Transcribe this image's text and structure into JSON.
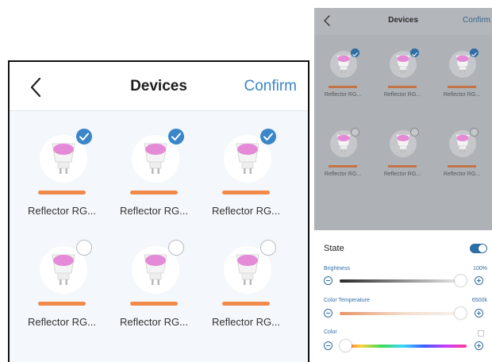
{
  "left": {
    "header": {
      "title": "Devices",
      "confirm": "Confirm"
    },
    "devices": [
      {
        "name": "Reflector RG...",
        "selected": true
      },
      {
        "name": "Reflector RG...",
        "selected": true
      },
      {
        "name": "Reflector RG...",
        "selected": true
      },
      {
        "name": "Reflector RG...",
        "selected": false
      },
      {
        "name": "Reflector RG...",
        "selected": false
      },
      {
        "name": "Reflector RG...",
        "selected": false
      }
    ]
  },
  "right": {
    "header": {
      "title": "Devices",
      "confirm": "Confirm"
    },
    "devices": [
      {
        "name": "Reflector RG...",
        "selected": true
      },
      {
        "name": "Reflector RG...",
        "selected": true
      },
      {
        "name": "Reflector RG...",
        "selected": true
      },
      {
        "name": "Reflector RG...",
        "selected": false
      },
      {
        "name": "Reflector RG...",
        "selected": false
      },
      {
        "name": "Reflector RG...",
        "selected": false
      }
    ],
    "sheet": {
      "state": {
        "label": "State",
        "on": true
      },
      "brightness": {
        "label": "Brightness",
        "value_text": "100%",
        "value": 1.0
      },
      "color_temperature": {
        "label": "Color Temperature",
        "value_text": "6500k",
        "value": 1.0
      },
      "color": {
        "label": "Color",
        "value": 0.0
      }
    }
  },
  "colors": {
    "accent": "#3b86c9",
    "bar": "#f08a4b",
    "bulb_light": "#e58ad6"
  },
  "icons": {
    "back": "chevron-left-icon",
    "selected": "checkmark-icon",
    "minus": "minus-circle-icon",
    "plus": "plus-circle-icon"
  }
}
